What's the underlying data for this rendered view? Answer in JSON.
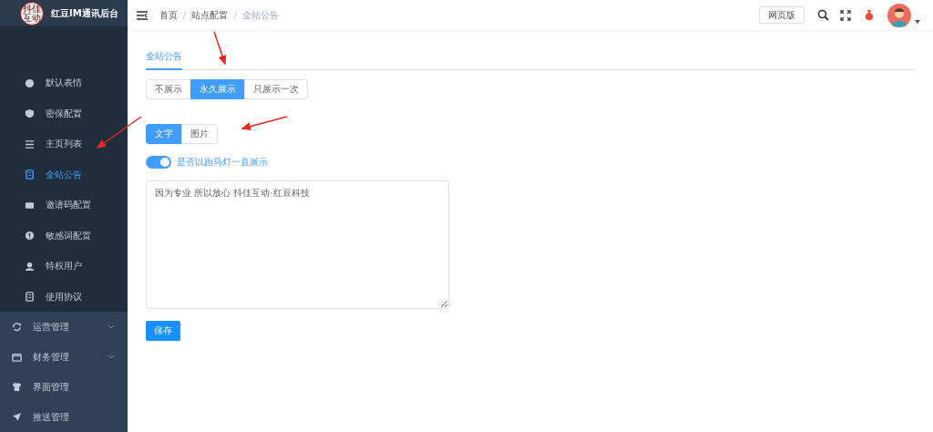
{
  "brand": {
    "logo_text": "抖佳互动",
    "title": "红豆IM通讯后台"
  },
  "breadcrumb": {
    "items": [
      "首页",
      "站点配置",
      "全站公告"
    ],
    "separators": [
      "/",
      "/"
    ]
  },
  "header_actions": {
    "web_button": "网页版"
  },
  "sidebar": {
    "sub_items": [
      {
        "label": "默认表情",
        "selected": false
      },
      {
        "label": "密保配置",
        "selected": false
      },
      {
        "label": "主页列表",
        "selected": false
      },
      {
        "label": "全站公告",
        "selected": true
      },
      {
        "label": "邀请码配置",
        "selected": false
      },
      {
        "label": "敏感词配置",
        "selected": false
      },
      {
        "label": "特权用户",
        "selected": false
      },
      {
        "label": "使用协议",
        "selected": false
      }
    ],
    "groups": [
      {
        "label": "运营管理",
        "expandable": true
      },
      {
        "label": "财务管理",
        "expandable": true
      },
      {
        "label": "界面管理",
        "expandable": false
      },
      {
        "label": "推送管理",
        "expandable": false
      }
    ]
  },
  "tabs": [
    {
      "label": "全站公告",
      "selected": true
    }
  ],
  "display_mode": [
    {
      "label": "不展示",
      "selected": false
    },
    {
      "label": "永久展示",
      "selected": true
    },
    {
      "label": "只展示一次",
      "selected": false
    }
  ],
  "content_type": [
    {
      "label": "文字",
      "selected": true
    },
    {
      "label": "图片",
      "selected": false
    }
  ],
  "marquee_switch": {
    "label": "是否以跑马灯一直展示",
    "on": true
  },
  "notice_text": "因为专业 所以放心 抖佳互动·红豆科技",
  "save_button": "保存"
}
